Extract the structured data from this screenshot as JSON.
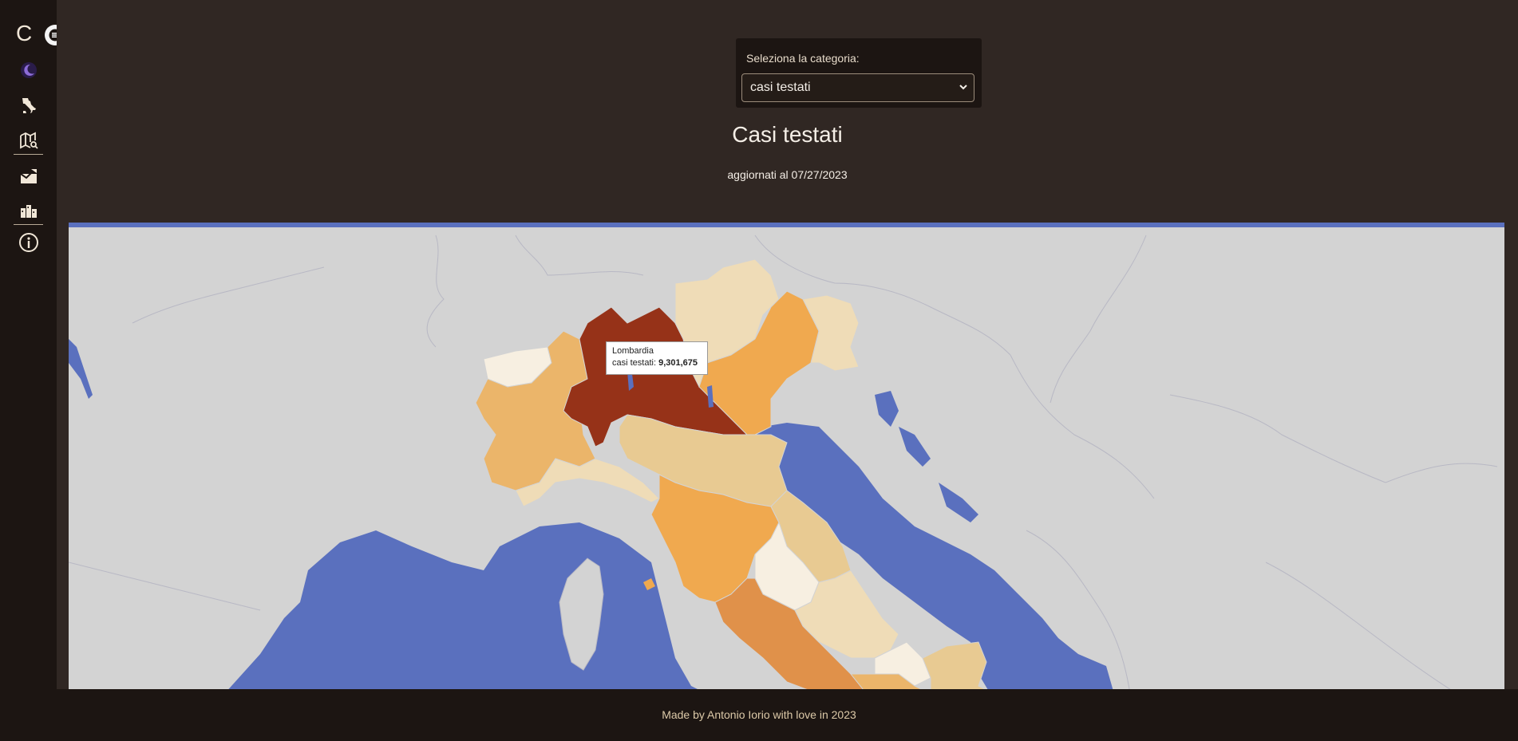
{
  "sidebar": {
    "brand": "C",
    "icons": [
      "theme-moon-icon",
      "italy-icon",
      "map-search-icon",
      "factory-icon",
      "city-icon",
      "info-icon"
    ]
  },
  "selector": {
    "label": "Seleziona la categoria:",
    "value": "casi testati"
  },
  "header": {
    "title": "Casi testati",
    "subtitle": "aggiornati al 07/27/2023"
  },
  "tooltip": {
    "region": "Lombardia",
    "metric_label": "casi testati:",
    "value": "9,301,675"
  },
  "map": {
    "sea_color": "#5a70be",
    "land_color": "#d3d3d3",
    "scale_colors": [
      "#f7efe1",
      "#efdcb7",
      "#e8ca92",
      "#ebb56a",
      "#f0a94f",
      "#e0914a",
      "#963218"
    ]
  },
  "footer": {
    "text": "Made by Antonio Iorio with love in 2023"
  }
}
